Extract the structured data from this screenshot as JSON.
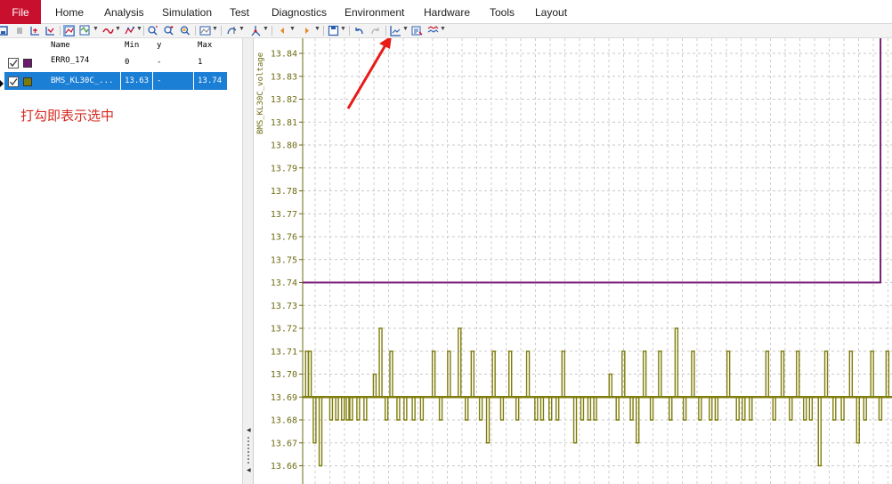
{
  "menu": {
    "file": "File",
    "items": [
      "Home",
      "Analysis",
      "Simulation",
      "Test",
      "Diagnostics",
      "Environment",
      "Hardware",
      "Tools",
      "Layout"
    ]
  },
  "toolbar": {
    "icons": [
      "signal-layout-icon",
      "stop-icon",
      "zoom-y-icon",
      "fit-y-icon",
      "graph-mode-icon",
      "scope-icon",
      "line-style-icon",
      "marker-icon",
      "zoom-in-icon",
      "zoom-out-icon",
      "zoom-fit-icon",
      "screenshot-icon",
      "cursor-icon",
      "measure-icon",
      "prev-icon",
      "next-icon",
      "save-icon",
      "undo-icon",
      "redo-icon",
      "chart-type-icon",
      "export-icon",
      "settings-icon"
    ]
  },
  "signal_list": {
    "headers": {
      "name": "Name",
      "min": "Min",
      "y": "y",
      "max": "Max"
    },
    "rows": [
      {
        "checked": true,
        "color": "#6e1a73",
        "name": "ERRO_174",
        "min": "0",
        "y": "-",
        "max": "1",
        "selected": false
      },
      {
        "checked": true,
        "color": "#7a7a08",
        "name": "BMS_KL30C_...",
        "min": "13.63",
        "y": "-",
        "max": "13.74",
        "selected": true
      }
    ]
  },
  "annotation": "打勾即表示选中",
  "colors": {
    "accent": "#c8102e",
    "selection": "#1c7fd6",
    "purple_signal": "#7a1f7a",
    "olive_signal": "#7f7d0b",
    "annotation_arrow": "#e81b17"
  },
  "chart_data": {
    "type": "line",
    "ylabel": "BMS_KL30C_voltage",
    "yticks": [
      "13.84",
      "13.83",
      "13.82",
      "13.81",
      "13.80",
      "13.79",
      "13.78",
      "13.77",
      "13.76",
      "13.75",
      "13.74",
      "13.73",
      "13.72",
      "13.71",
      "13.70",
      "13.69",
      "13.68",
      "13.67",
      "13.66"
    ],
    "ylim": [
      13.655,
      13.845
    ],
    "grid": true,
    "series": [
      {
        "signal": "ERRO_174",
        "color": "#7a1f7a",
        "level_value": 13.74,
        "step_to_top_at_fraction": 0.985
      },
      {
        "signal": "BMS_KL30C_voltage",
        "color": "#7f7d0b",
        "baseline": 13.69,
        "spikes": [
          [
            0.005,
            13.71
          ],
          [
            0.01,
            13.71
          ],
          [
            0.018,
            13.67
          ],
          [
            0.028,
            13.66
          ],
          [
            0.046,
            13.68
          ],
          [
            0.056,
            13.68
          ],
          [
            0.066,
            13.68
          ],
          [
            0.074,
            13.68
          ],
          [
            0.08,
            13.68
          ],
          [
            0.092,
            13.68
          ],
          [
            0.104,
            13.68
          ],
          [
            0.12,
            13.7
          ],
          [
            0.13,
            13.72
          ],
          [
            0.14,
            13.68
          ],
          [
            0.148,
            13.71
          ],
          [
            0.16,
            13.68
          ],
          [
            0.172,
            13.68
          ],
          [
            0.186,
            13.68
          ],
          [
            0.2,
            13.68
          ],
          [
            0.22,
            13.71
          ],
          [
            0.232,
            13.68
          ],
          [
            0.246,
            13.71
          ],
          [
            0.264,
            13.72
          ],
          [
            0.276,
            13.68
          ],
          [
            0.286,
            13.71
          ],
          [
            0.3,
            13.68
          ],
          [
            0.312,
            13.67
          ],
          [
            0.322,
            13.71
          ],
          [
            0.336,
            13.68
          ],
          [
            0.35,
            13.71
          ],
          [
            0.362,
            13.68
          ],
          [
            0.38,
            13.71
          ],
          [
            0.394,
            13.68
          ],
          [
            0.404,
            13.68
          ],
          [
            0.418,
            13.68
          ],
          [
            0.43,
            13.68
          ],
          [
            0.44,
            13.71
          ],
          [
            0.46,
            13.67
          ],
          [
            0.472,
            13.68
          ],
          [
            0.484,
            13.68
          ],
          [
            0.494,
            13.68
          ],
          [
            0.52,
            13.7
          ],
          [
            0.532,
            13.68
          ],
          [
            0.542,
            13.71
          ],
          [
            0.556,
            13.68
          ],
          [
            0.566,
            13.67
          ],
          [
            0.578,
            13.71
          ],
          [
            0.59,
            13.68
          ],
          [
            0.604,
            13.71
          ],
          [
            0.622,
            13.68
          ],
          [
            0.632,
            13.72
          ],
          [
            0.646,
            13.68
          ],
          [
            0.66,
            13.71
          ],
          [
            0.672,
            13.68
          ],
          [
            0.69,
            13.68
          ],
          [
            0.7,
            13.68
          ],
          [
            0.72,
            13.71
          ],
          [
            0.736,
            13.68
          ],
          [
            0.746,
            13.68
          ],
          [
            0.758,
            13.68
          ],
          [
            0.786,
            13.71
          ],
          [
            0.798,
            13.68
          ],
          [
            0.812,
            13.71
          ],
          [
            0.826,
            13.68
          ],
          [
            0.838,
            13.71
          ],
          [
            0.85,
            13.68
          ],
          [
            0.86,
            13.68
          ],
          [
            0.875,
            13.66
          ],
          [
            0.886,
            13.71
          ],
          [
            0.9,
            13.68
          ],
          [
            0.914,
            13.68
          ],
          [
            0.928,
            13.71
          ],
          [
            0.94,
            13.67
          ],
          [
            0.952,
            13.68
          ],
          [
            0.964,
            13.71
          ],
          [
            0.978,
            13.68
          ],
          [
            0.99,
            13.71
          ]
        ]
      }
    ]
  }
}
